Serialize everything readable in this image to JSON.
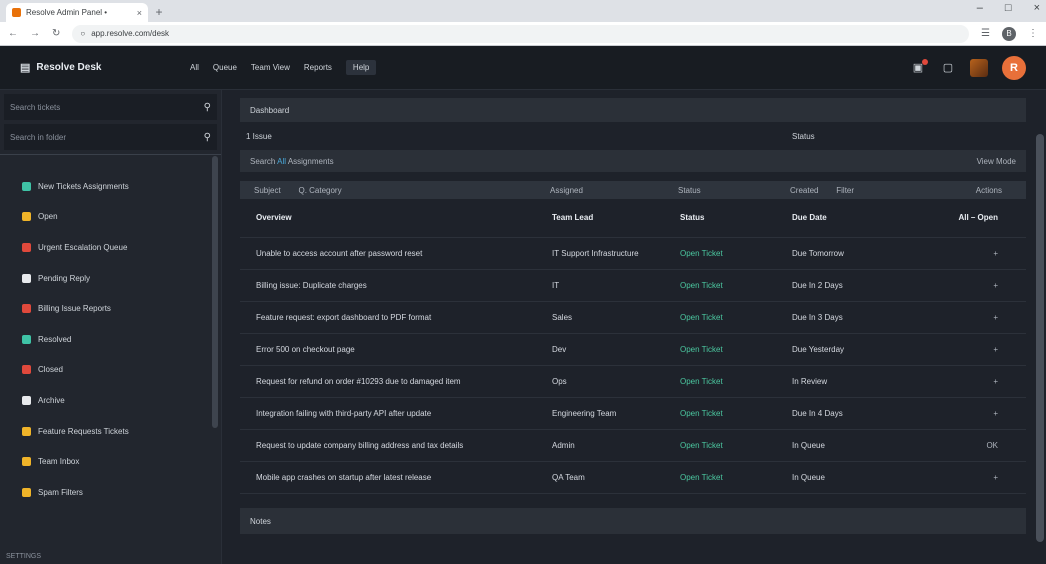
{
  "browser": {
    "tab_title": "Resolve Admin Panel •",
    "tab_close": "×",
    "new_tab": "+",
    "window_controls": [
      "–",
      "□",
      "×"
    ],
    "url": "app.resolve.com/desk",
    "profile": "B"
  },
  "header": {
    "brand": "Resolve Desk",
    "nav": [
      "All",
      "Queue",
      "Team View",
      "Reports",
      "Help"
    ],
    "accent": "#e8703a",
    "avatar_initial": "R"
  },
  "sidebar": {
    "search1_placeholder": "Search tickets",
    "search2_placeholder": "Search in folder",
    "items": [
      {
        "label": "New Tickets Assignments",
        "color": "#3fc3a6"
      },
      {
        "label": "Open",
        "color": "#f0b429"
      },
      {
        "label": "Urgent Escalation Queue",
        "color": "#e0493c"
      },
      {
        "label": "Pending Reply",
        "color": "#e8eaed"
      },
      {
        "label": "Billing Issue Reports",
        "color": "#e0493c"
      },
      {
        "label": "Resolved",
        "color": "#3fc3a6"
      },
      {
        "label": "Closed",
        "color": "#e0493c"
      },
      {
        "label": "Archive",
        "color": "#e8eaed"
      },
      {
        "label": "Feature Requests Tickets",
        "color": "#f0b429"
      },
      {
        "label": "Team Inbox",
        "color": "#f0b429"
      },
      {
        "label": "Spam Filters",
        "color": "#f0b429"
      }
    ],
    "footer": "SETTINGS"
  },
  "main": {
    "panel_title": "Dashboard",
    "meta_left": "1 Issue",
    "meta_right": "Status",
    "filter_prefix": "Search",
    "filter_highlight": "All",
    "filter_rest": "Assignments",
    "filter_right": "View Mode",
    "columns": [
      "Subject",
      "Q. Category",
      "Assigned",
      "Status",
      "Created",
      "Filter",
      "Actions"
    ],
    "head_row": {
      "subject": "Overview",
      "assignee": "Team Lead",
      "status": "Status",
      "date": "Due Date",
      "action": "All – Open"
    },
    "rows": [
      {
        "subject": "Unable to access account after password reset",
        "assignee": "IT Support Infrastructure",
        "status": "Open Ticket",
        "date": "Due Tomorrow",
        "action": "+"
      },
      {
        "subject": "Billing issue: Duplicate charges",
        "assignee": "IT",
        "status": "Open Ticket",
        "date": "Due In 2 Days",
        "action": "+"
      },
      {
        "subject": "Feature request: export dashboard to PDF format",
        "assignee": "Sales",
        "status": "Open Ticket",
        "date": "Due In 3 Days",
        "action": "+"
      },
      {
        "subject": "Error 500 on checkout page",
        "assignee": "Dev",
        "status": "Open Ticket",
        "date": "Due Yesterday",
        "action": "+"
      },
      {
        "subject": "Request for refund on order #10293 due to damaged item",
        "assignee": "Ops",
        "status": "Open Ticket",
        "date": "In Review",
        "action": "+"
      },
      {
        "subject": "Integration failing with third-party API after update",
        "assignee": "Engineering Team",
        "status": "Open Ticket",
        "date": "Due In 4 Days",
        "action": "+"
      },
      {
        "subject": "Request to update company billing address and tax details",
        "assignee": "Admin",
        "status": "Open Ticket",
        "date": "In Queue",
        "action": "OK"
      },
      {
        "subject": "Mobile app crashes on startup after latest release",
        "assignee": "QA Team",
        "status": "Open Ticket",
        "date": "In Queue",
        "action": "+"
      }
    ],
    "footer_label": "Notes"
  }
}
